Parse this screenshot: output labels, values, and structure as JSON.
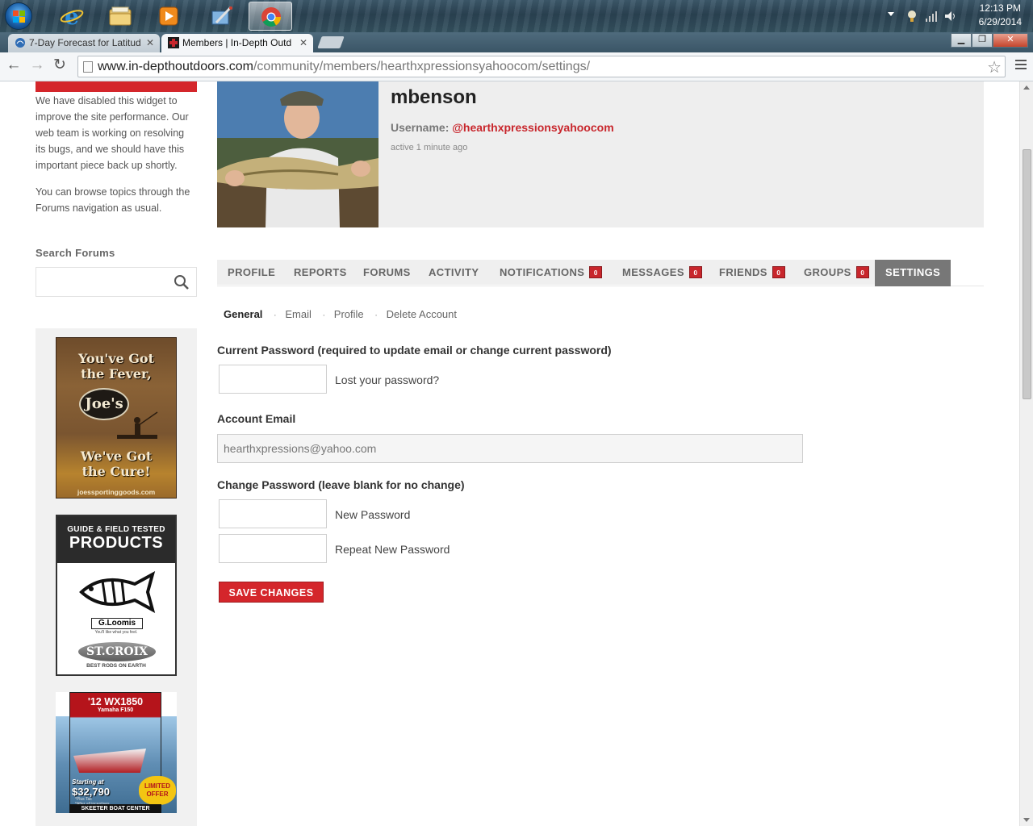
{
  "os": {
    "clock_time": "12:13 PM",
    "clock_date": "6/29/2014",
    "taskbar_apps": [
      "start-orb",
      "internet-explorer",
      "file-explorer",
      "media-player",
      "control-panel",
      "chrome"
    ]
  },
  "browser": {
    "tabs": [
      {
        "title": "7-Day Forecast for Latitud",
        "active": false
      },
      {
        "title": "Members | In-Depth Outd",
        "active": true
      }
    ],
    "url_host": "www.in-depthoutdoors.com",
    "url_path": "/community/members/hearthxpressionsyahoocom/settings/"
  },
  "sidebar": {
    "notice_p1": "We have disabled this widget to improve the site performance. Our web team is working on resolving its bugs, and we should have this important piece back up shortly.",
    "notice_p2": "You can browse topics through the Forums navigation as usual.",
    "search_label": "Search Forums",
    "search_placeholder": "",
    "ads": {
      "joes": {
        "line1": "You've Got",
        "line2": "the Fever,",
        "logo": "Joe's",
        "line3": "We've Got",
        "line4": "the Cure!",
        "site": "joessportinggoods.com"
      },
      "products": {
        "small": "GUIDE & FIELD TESTED",
        "big": "PRODUCTS",
        "brand1": "G.Loomis",
        "brand1_tag": "You'll like what you feel.",
        "brand2": "ST.CROIX",
        "brand2_tag": "BEST RODS ON EARTH"
      },
      "skeeter": {
        "model": "'12 WX1850",
        "engine": "Yamaha F150",
        "starting": "Starting at",
        "price": "$32,790",
        "fine1": "*Plus Tax",
        "fine2": "*After all incentives",
        "offer": "LIMITED OFFER",
        "footer": "SKEETER BOAT CENTER"
      }
    }
  },
  "profile": {
    "display_name": "mbenson",
    "username_label": "Username:",
    "username": "@hearthxpressionsyahoocom",
    "last_active": "active 1 minute ago"
  },
  "tabs": [
    {
      "label": "PROFILE",
      "count": null
    },
    {
      "label": "REPORTS",
      "count": null
    },
    {
      "label": "FORUMS",
      "count": null
    },
    {
      "label": "ACTIVITY",
      "count": null
    },
    {
      "label": "NOTIFICATIONS",
      "count": "0"
    },
    {
      "label": "MESSAGES",
      "count": "0"
    },
    {
      "label": "FRIENDS",
      "count": "0"
    },
    {
      "label": "GROUPS",
      "count": "0"
    },
    {
      "label": "SETTINGS",
      "count": null,
      "current": true
    }
  ],
  "subnav": {
    "general": "General",
    "email": "Email",
    "profile": "Profile",
    "delete": "Delete Account",
    "separator": "·"
  },
  "form": {
    "current_password_label": "Current Password (required to update email or change current password)",
    "current_password_value": "",
    "lost_password": "Lost your password?",
    "account_email_label": "Account Email",
    "account_email_value": "hearthxpressions@yahoo.com",
    "change_password_label": "Change Password (leave blank for no change)",
    "new_password_label": "New Password",
    "repeat_password_label": "Repeat New Password",
    "save_label": "SAVE CHANGES"
  },
  "colors": {
    "brand_red": "#d4262b",
    "tab_current": "#777777",
    "tab_default": "#efefef"
  }
}
